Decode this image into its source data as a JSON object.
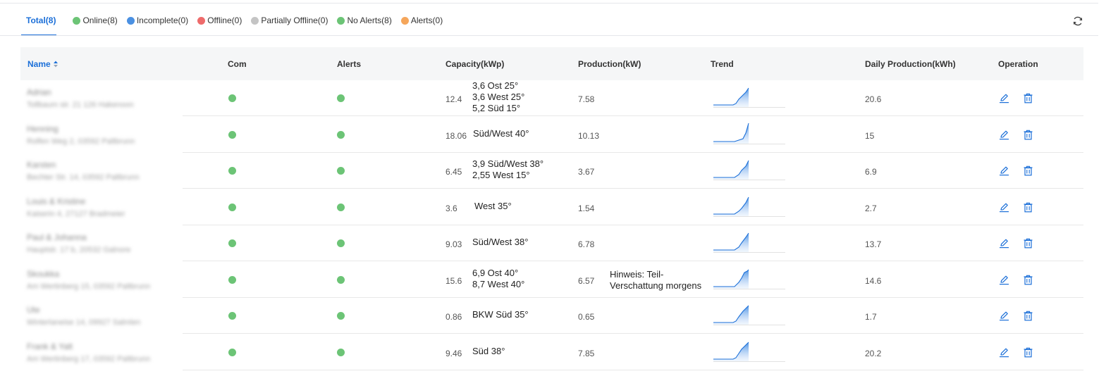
{
  "filters": [
    {
      "label": "Total(8)",
      "color": null,
      "active": true
    },
    {
      "label": "Online(8)",
      "color": "#6cc476"
    },
    {
      "label": "Incomplete(0)",
      "color": "#4a90e2"
    },
    {
      "label": "Offline(0)",
      "color": "#ee6b6b"
    },
    {
      "label": "Partially Offline(0)",
      "color": "#c4c4c4"
    },
    {
      "label": "No Alerts(8)",
      "color": "#6cc476"
    },
    {
      "label": "Alerts(0)",
      "color": "#f5a65b"
    }
  ],
  "icons": {
    "refresh": "refresh-icon",
    "sort": "sort-icon",
    "edit": "edit-icon",
    "delete": "trash-icon"
  },
  "accent_color": "#1b6fd8",
  "status_color": "#6cc476",
  "columns": {
    "name": "Name",
    "com": "Com",
    "alerts": "Alerts",
    "capacity": "Capacity(kWp)",
    "production": "Production(kW)",
    "trend": "Trend",
    "daily": "Daily Production(kWh)",
    "operation": "Operation"
  },
  "rows": [
    {
      "name": "Adrian",
      "address": "Tollbaum str. 21 126 Hakenoon",
      "capacity": "12.4",
      "orientation": [
        "3,6 Ost 25°",
        "3,6 West 25°",
        "5,2 Süd 15°"
      ],
      "production": "7.58",
      "note": [],
      "daily": "20.6"
    },
    {
      "name": "Henning",
      "address": "Rolfen Weg 2, 03592 Paltbrunn",
      "capacity": "18.06",
      "orientation": [
        "Süd/West 40°"
      ],
      "production": "10.13",
      "note": [],
      "daily": "15"
    },
    {
      "name": "Karsten",
      "address": "Bechter Str. 14, 03592 Paltbrunn",
      "capacity": "6.45",
      "orientation": [
        "3,9 Süd/West 38°",
        "2,55 West 15°"
      ],
      "production": "3.67",
      "note": [],
      "daily": "6.9"
    },
    {
      "name": "Louis & Kristine",
      "address": "Kaiserin 4, 27127 Bradmeier",
      "capacity": "3.6",
      "orientation": [
        "West 35°"
      ],
      "production": "1.54",
      "note": [],
      "daily": "2.7"
    },
    {
      "name": "Paul & Johanna",
      "address": "Hauptstr. 17 b, 20532 Galnore",
      "capacity": "9.03",
      "orientation": [
        "Süd/West 38°"
      ],
      "production": "6.78",
      "note": [],
      "daily": "13.7"
    },
    {
      "name": "Skoukka",
      "address": "Am Wertinberg 15, 03592 Paltbrunn",
      "capacity": "15.6",
      "orientation": [
        "6,9 Ost 40°",
        "8,7 West 40°"
      ],
      "production": "6.57",
      "note": [
        "Hinweis: Teil-",
        "Verschattung morgens"
      ],
      "daily": "14.6"
    },
    {
      "name": "Ute",
      "address": "Winterlaneise 14, 09927 Salmlen",
      "capacity": "0.86",
      "orientation": [
        "BKW Süd 35°"
      ],
      "production": "0.65",
      "note": [],
      "daily": "1.7"
    },
    {
      "name": "Frank & Yalt",
      "address": "Am Wertinberg 17, 03592 Paltbrunn",
      "capacity": "9.46",
      "orientation": [
        "Süd 38°"
      ],
      "production": "7.85",
      "note": [],
      "daily": "20.2"
    }
  ]
}
